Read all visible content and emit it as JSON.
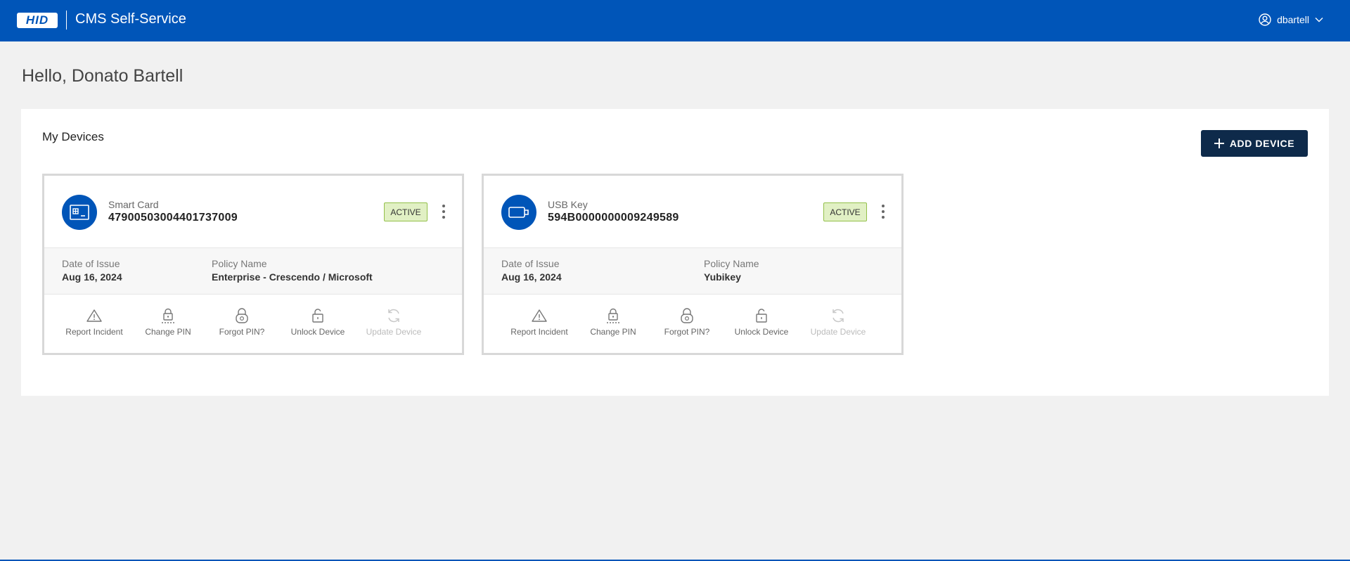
{
  "header": {
    "logo_text": "HID",
    "app_title": "CMS Self-Service",
    "username": "dbartell",
    "brand_color": "#0055b8"
  },
  "greeting": "Hello, Donato Bartell",
  "devices_panel": {
    "title": "My Devices",
    "add_button_label": "ADD DEVICE"
  },
  "labels": {
    "date_of_issue": "Date of Issue",
    "policy_name": "Policy Name"
  },
  "devices": [
    {
      "type": "Smart Card",
      "serial": "47900503004401737009",
      "status": "ACTIVE",
      "icon": "smart-card-icon",
      "date_of_issue": "Aug 16, 2024",
      "policy_name": "Enterprise - Crescendo / Microsoft",
      "actions": [
        {
          "label": "Report Incident",
          "icon": "warning-icon",
          "enabled": true
        },
        {
          "label": "Change PIN",
          "icon": "lock-pin-icon",
          "enabled": true
        },
        {
          "label": "Forgot PIN?",
          "icon": "lock-question-icon",
          "enabled": true
        },
        {
          "label": "Unlock Device",
          "icon": "unlock-icon",
          "enabled": true
        },
        {
          "label": "Update Device",
          "icon": "refresh-icon",
          "enabled": false
        }
      ]
    },
    {
      "type": "USB Key",
      "serial": "594B0000000009249589",
      "status": "ACTIVE",
      "icon": "usb-key-icon",
      "date_of_issue": "Aug 16, 2024",
      "policy_name": "Yubikey",
      "actions": [
        {
          "label": "Report Incident",
          "icon": "warning-icon",
          "enabled": true
        },
        {
          "label": "Change PIN",
          "icon": "lock-pin-icon",
          "enabled": true
        },
        {
          "label": "Forgot PIN?",
          "icon": "lock-question-icon",
          "enabled": true
        },
        {
          "label": "Unlock Device",
          "icon": "unlock-icon",
          "enabled": true
        },
        {
          "label": "Update Device",
          "icon": "refresh-icon",
          "enabled": false
        }
      ]
    }
  ]
}
